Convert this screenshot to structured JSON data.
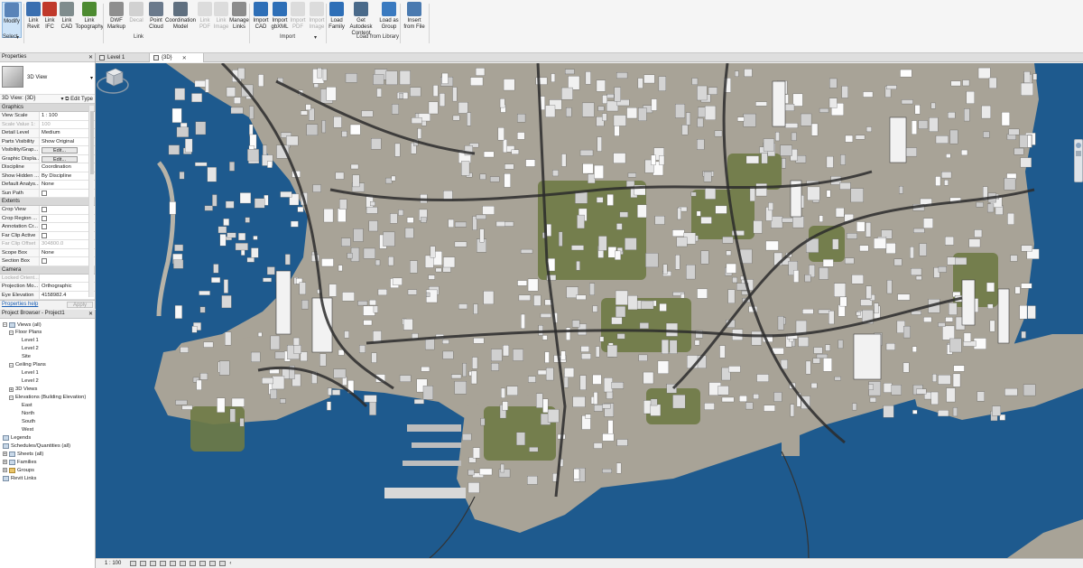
{
  "ribbon": {
    "buttons": [
      {
        "id": "modify",
        "label": "Modify",
        "state": "active"
      },
      {
        "id": "link-revit",
        "label": "Link\nRevit",
        "state": "normal"
      },
      {
        "id": "link-ifc",
        "label": "Link\nIFC",
        "state": "normal"
      },
      {
        "id": "link-cad",
        "label": "Link\nCAD",
        "state": "normal"
      },
      {
        "id": "link-topography",
        "label": "Link\nTopography",
        "state": "normal"
      },
      {
        "id": "dwf-markup",
        "label": "DWF\nMarkup",
        "state": "normal"
      },
      {
        "id": "decal",
        "label": "Decal",
        "state": "disabled"
      },
      {
        "id": "point-cloud",
        "label": "Point\nCloud",
        "state": "normal"
      },
      {
        "id": "coordination-model",
        "label": "Coordination\nModel",
        "state": "normal"
      },
      {
        "id": "link-pdf",
        "label": "Link\nPDF",
        "state": "disabled"
      },
      {
        "id": "link-image",
        "label": "Link\nImage",
        "state": "disabled"
      },
      {
        "id": "manage-links",
        "label": "Manage\nLinks",
        "state": "normal"
      },
      {
        "id": "import-cad",
        "label": "Import\nCAD",
        "state": "normal"
      },
      {
        "id": "import-gbxml",
        "label": "Import\ngbXML",
        "state": "normal"
      },
      {
        "id": "import-pdf",
        "label": "Import\nPDF",
        "state": "disabled"
      },
      {
        "id": "import-image",
        "label": "Import\nImage",
        "state": "disabled"
      },
      {
        "id": "load-family",
        "label": "Load\nFamily",
        "state": "normal"
      },
      {
        "id": "get-autodesk-content",
        "label": "Get Autodesk\nContent",
        "state": "normal"
      },
      {
        "id": "load-as-group",
        "label": "Load as\nGroup",
        "state": "normal"
      },
      {
        "id": "insert-from-file",
        "label": "Insert\nfrom File",
        "state": "normal"
      }
    ],
    "groups": {
      "select": "Select",
      "link": "Link",
      "import": "Import",
      "load_from_library": "Load from Library"
    }
  },
  "tabs": [
    {
      "label": "Level 1",
      "active": false
    },
    {
      "label": "{3D}",
      "active": true
    }
  ],
  "properties": {
    "title": "Properties",
    "type_name": "3D View",
    "view_selector": "3D View: {3D}",
    "edit_type": "Edit Type",
    "categories": {
      "graphics": "Graphics",
      "extents": "Extents",
      "camera": "Camera"
    },
    "graphics": [
      {
        "key": "View Scale",
        "value": "1 : 100",
        "kind": "text",
        "grey": false
      },
      {
        "key": "Scale Value    1:",
        "value": "100",
        "kind": "text",
        "grey": true
      },
      {
        "key": "Detail Level",
        "value": "Medium",
        "kind": "text",
        "grey": false
      },
      {
        "key": "Parts Visibility",
        "value": "Show Original",
        "kind": "text",
        "grey": false
      },
      {
        "key": "Visibility/Grap...",
        "value": "Edit...",
        "kind": "button",
        "grey": false
      },
      {
        "key": "Graphic Displa...",
        "value": "Edit...",
        "kind": "button",
        "grey": false
      },
      {
        "key": "Discipline",
        "value": "Coordination",
        "kind": "text",
        "grey": false
      },
      {
        "key": "Show Hidden ...",
        "value": "By Discipline",
        "kind": "text",
        "grey": false
      },
      {
        "key": "Default Analys...",
        "value": "None",
        "kind": "text",
        "grey": false
      },
      {
        "key": "Sun Path",
        "value": "",
        "kind": "check",
        "grey": false
      }
    ],
    "extents": [
      {
        "key": "Crop View",
        "value": "",
        "kind": "check",
        "grey": false
      },
      {
        "key": "Crop Region ...",
        "value": "",
        "kind": "check",
        "grey": false
      },
      {
        "key": "Annotation Cr...",
        "value": "",
        "kind": "check",
        "grey": false
      },
      {
        "key": "Far Clip Active",
        "value": "",
        "kind": "check",
        "grey": false
      },
      {
        "key": "Far Clip Offset",
        "value": "304800.0",
        "kind": "text",
        "grey": true
      },
      {
        "key": "Scope Box",
        "value": "None",
        "kind": "text",
        "grey": false
      },
      {
        "key": "Section Box",
        "value": "",
        "kind": "check",
        "grey": false
      }
    ],
    "camera": [
      {
        "key": "Locked Orient...",
        "value": "",
        "kind": "text",
        "grey": true
      },
      {
        "key": "Projection Mo...",
        "value": "Orthographic",
        "kind": "text",
        "grey": false
      },
      {
        "key": "Eye Elevation",
        "value": "4158982.4",
        "kind": "text",
        "grey": false
      }
    ],
    "help_link": "Properties help",
    "apply": "Apply"
  },
  "browser": {
    "title": "Project Browser - Project1",
    "items": [
      {
        "label": "Views (all)",
        "level": 0,
        "exp": "−",
        "icon": "views"
      },
      {
        "label": "Floor Plans",
        "level": 1,
        "exp": "−",
        "icon": "none"
      },
      {
        "label": "Level 1",
        "level": 3,
        "exp": "",
        "icon": "none"
      },
      {
        "label": "Level 2",
        "level": 3,
        "exp": "",
        "icon": "none"
      },
      {
        "label": "Site",
        "level": 3,
        "exp": "",
        "icon": "none"
      },
      {
        "label": "Ceiling Plans",
        "level": 1,
        "exp": "−",
        "icon": "none"
      },
      {
        "label": "Level 1",
        "level": 3,
        "exp": "",
        "icon": "none"
      },
      {
        "label": "Level 2",
        "level": 3,
        "exp": "",
        "icon": "none"
      },
      {
        "label": "3D Views",
        "level": 1,
        "exp": "+",
        "icon": "none"
      },
      {
        "label": "Elevations (Building Elevation)",
        "level": 1,
        "exp": "−",
        "icon": "none"
      },
      {
        "label": "East",
        "level": 3,
        "exp": "",
        "icon": "none"
      },
      {
        "label": "North",
        "level": 3,
        "exp": "",
        "icon": "none"
      },
      {
        "label": "South",
        "level": 3,
        "exp": "",
        "icon": "none"
      },
      {
        "label": "West",
        "level": 3,
        "exp": "",
        "icon": "none"
      },
      {
        "label": "Legends",
        "level": 0,
        "exp": "",
        "icon": "doc"
      },
      {
        "label": "Schedules/Quantities (all)",
        "level": 0,
        "exp": "",
        "icon": "doc"
      },
      {
        "label": "Sheets (all)",
        "level": 0,
        "exp": "+",
        "icon": "doc"
      },
      {
        "label": "Families",
        "level": 0,
        "exp": "+",
        "icon": "doc"
      },
      {
        "label": "Groups",
        "level": 0,
        "exp": "+",
        "icon": "folder"
      },
      {
        "label": "Revit Links",
        "level": 0,
        "exp": "",
        "icon": "link"
      }
    ]
  },
  "statusbar": {
    "scale": "1 : 100"
  },
  "colors": {
    "water": "#1e5a8e",
    "land": "#a8a397",
    "building": "#e6e6e6",
    "park": "#6e7a45",
    "road": "#2c2c2c"
  }
}
